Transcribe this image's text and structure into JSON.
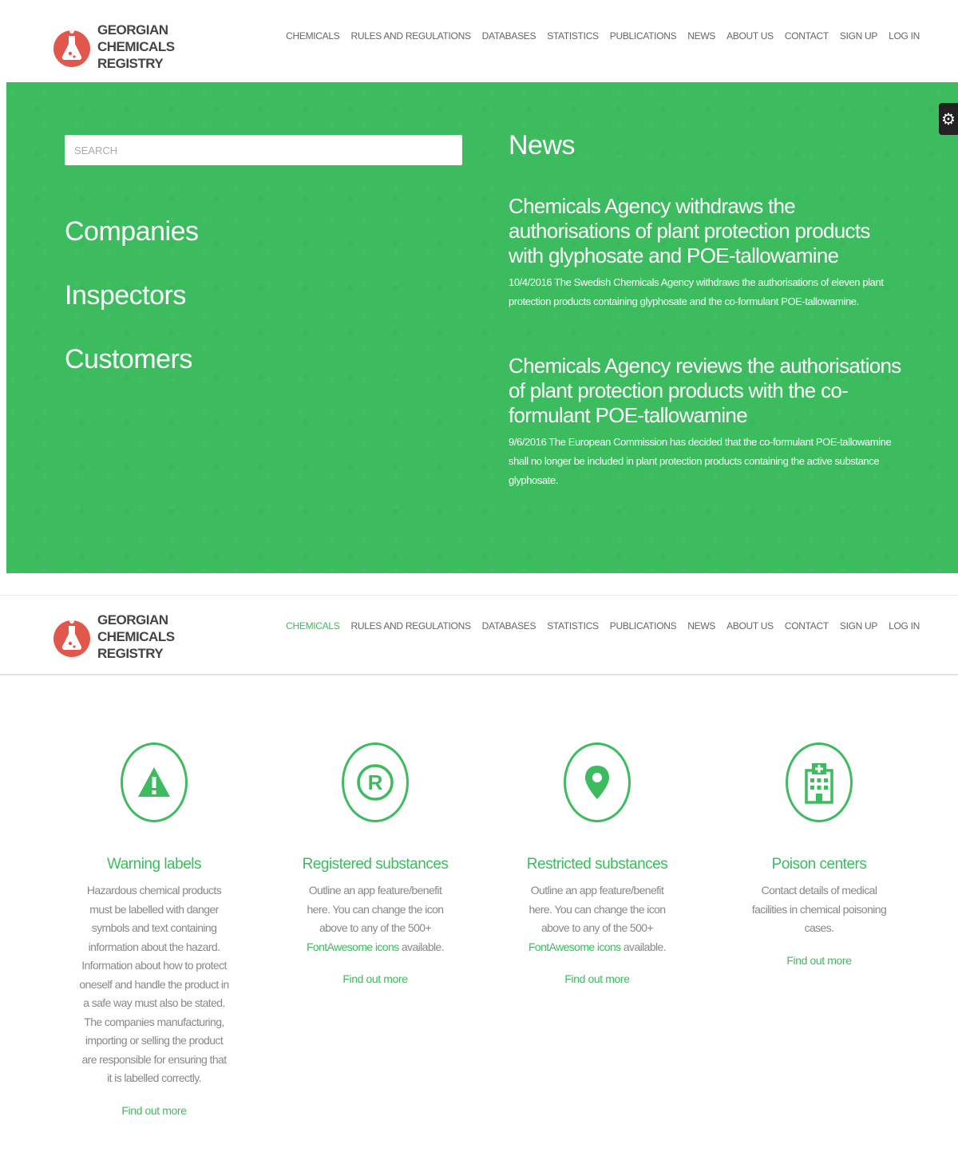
{
  "brand": {
    "name_lines": [
      "GEORGIAN",
      "CHEMICALS",
      "REGISTRY"
    ],
    "logo_icon": "flask-icon",
    "accent_color": "#3dbb5f",
    "logo_color": "#e2574c"
  },
  "nav": {
    "items": [
      "CHEMICALS",
      "RULES AND REGULATIONS",
      "DATABASES",
      "STATISTICS",
      "PUBLICATIONS",
      "NEWS",
      "ABOUT US",
      "CONTACT",
      "SIGN UP",
      "LOG IN"
    ]
  },
  "hero": {
    "search": {
      "placeholder": "SEARCH"
    },
    "links": [
      "Companies",
      "Inspectors",
      "Customers"
    ],
    "news_title": "News",
    "news": [
      {
        "title": "Chemicals Agency withdraws the authorisations of plant protection products with glyphosate and POE-tallowamine",
        "body": "10/4/2016 The Swedish Chemicals Agency withdraws the authorisations of eleven plant protection products containing glyphosate and the co-formulant POE-tallowamine."
      },
      {
        "title": "Chemicals Agency reviews the authorisations of plant protection products with the co-formulant POE-tallowamine",
        "body": "9/6/2016 The European Commission has decided that the co-formulant POE-tallowamine shall no longer be included in plant protection products containing the active substance glyphosate."
      }
    ],
    "settings_icon": "gear-icon"
  },
  "features": [
    {
      "icon": "warning-icon",
      "title": "Warning labels",
      "text": "Hazardous chemical products must be labelled with danger symbols and text containing information about the hazard. Information about how to protect oneself and handle the product in a safe way must also be stated. The companies manufacturing, importing or selling the product are responsible for ensuring that it is labelled correctly.",
      "more": "Find out more"
    },
    {
      "icon": "registered-icon",
      "title": "Registered substances",
      "text_before": "Outline an app feature/benefit here. You can change the icon above to any of the 500+ ",
      "link": "FontAwesome icons",
      "text_after": " available.",
      "more": "Find out more"
    },
    {
      "icon": "map-marker-icon",
      "title": "Restricted substances",
      "text_before": "Outline an app feature/benefit here. You can change the icon above to any of the 500+ ",
      "link": "FontAwesome icons",
      "text_after": " available.",
      "more": "Find out more"
    },
    {
      "icon": "hospital-icon",
      "title": "Poison centers",
      "text": "Contact details of medical facilities in chemical poisoning cases.",
      "more": "Find out more"
    }
  ]
}
